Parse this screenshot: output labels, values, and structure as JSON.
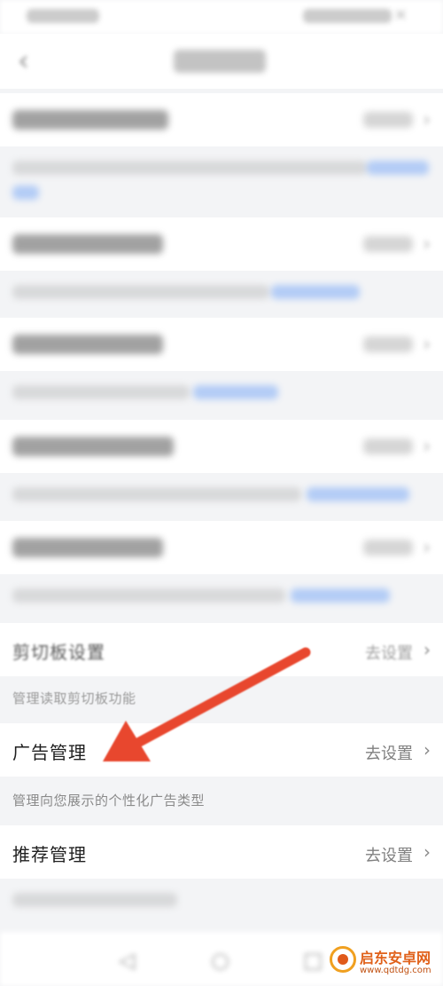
{
  "clipboard": {
    "label": "剪切板设置",
    "action": "去设置",
    "description": "管理读取剪切板功能"
  },
  "ads": {
    "label": "广告管理",
    "action": "去设置",
    "description": "管理向您展示的个性化广告类型"
  },
  "recommend": {
    "label": "推荐管理",
    "action": "去设置"
  },
  "chevron": "›",
  "annotation": {
    "arrow_color": "#e8472e"
  },
  "watermark": {
    "name": "启东安卓网",
    "url": "www.qdtdg.com"
  },
  "icons": {
    "back": "chevron-left-icon",
    "settings_chevron": "chevron-right-icon",
    "nav": [
      "back-triangle-icon",
      "home-circle-icon",
      "recents-square-icon"
    ]
  }
}
